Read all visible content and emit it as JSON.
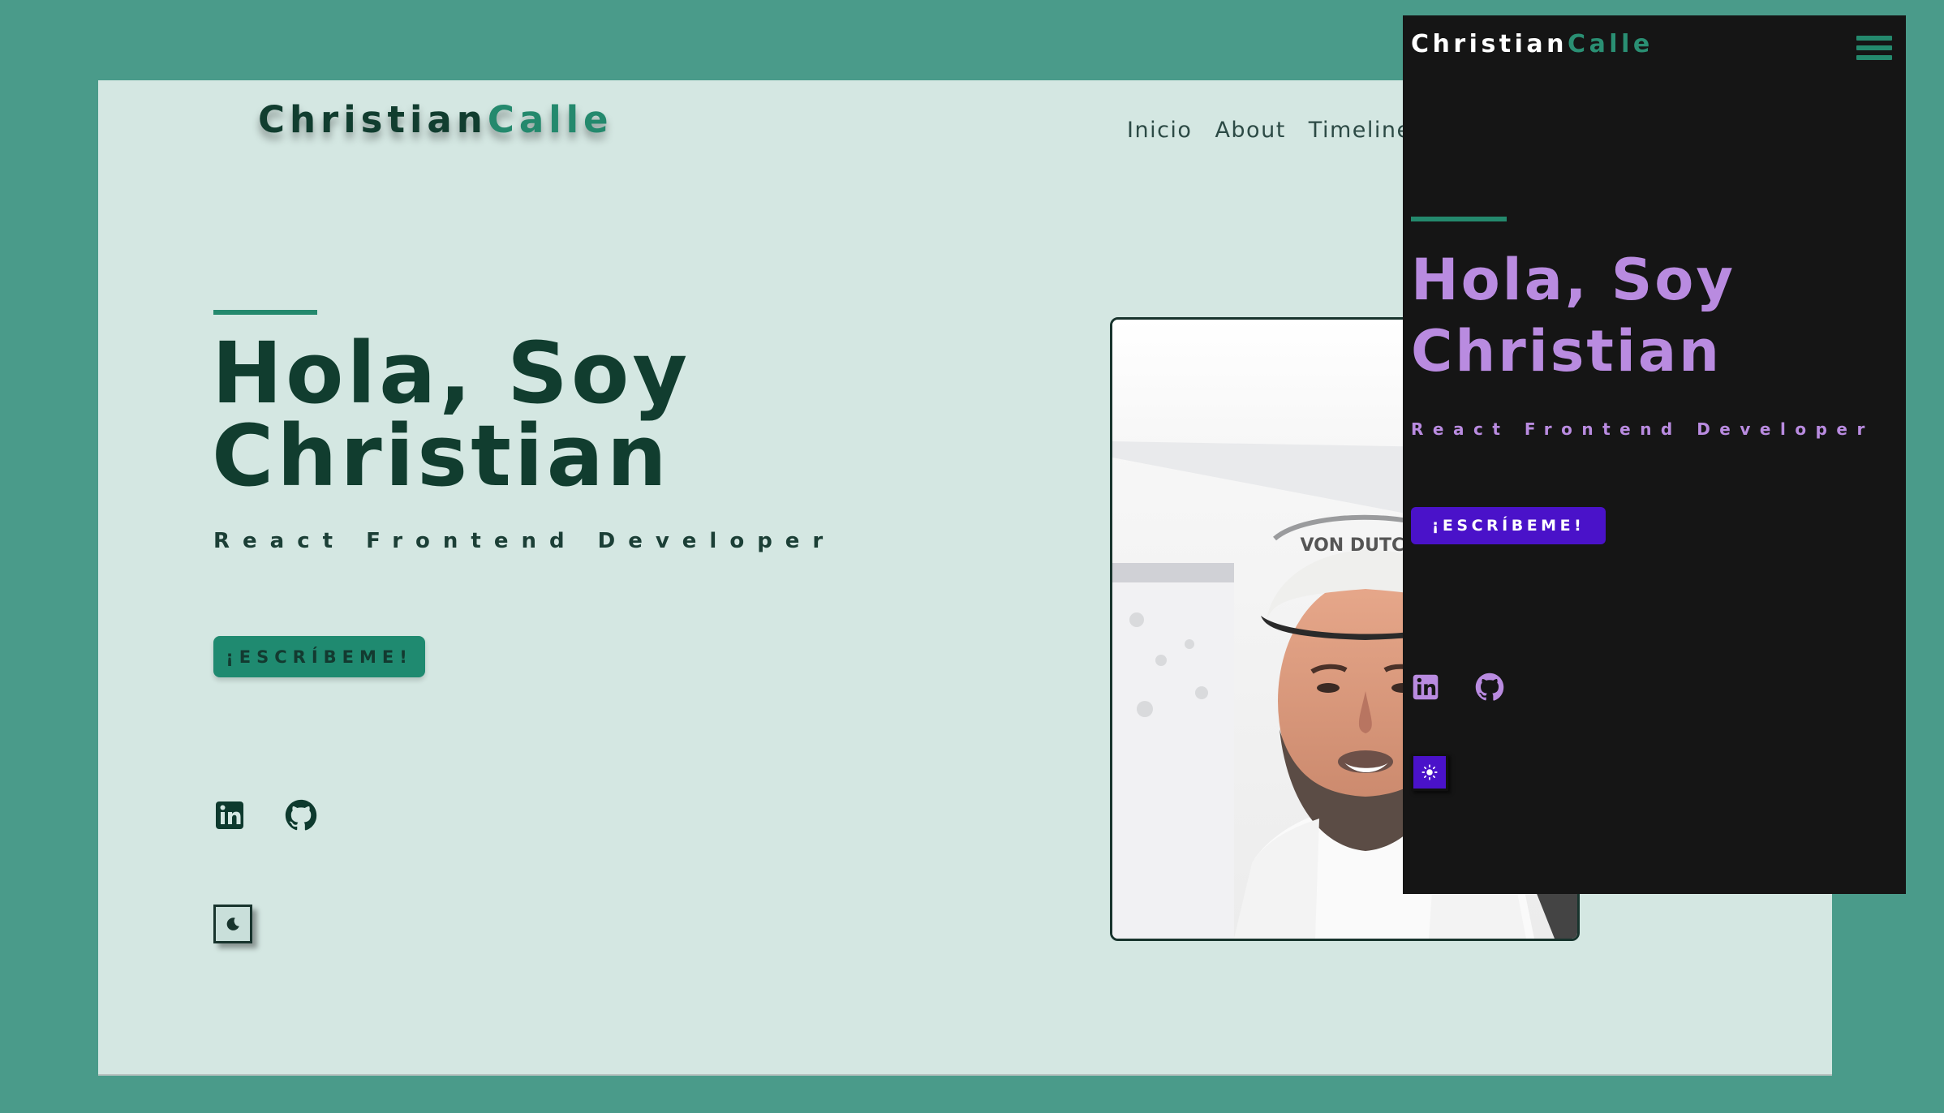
{
  "light_view": {
    "logo": {
      "first": "Christian",
      "last": "Calle"
    },
    "nav": [
      "Inicio",
      "About",
      "Timeline"
    ],
    "hero": {
      "title": "Hola, Soy Christian",
      "subtitle": "React Frontend Developer",
      "cta": "¡ESCRÍBEME!"
    },
    "socials": [
      {
        "icon": "linkedin-icon"
      },
      {
        "icon": "github-icon"
      }
    ],
    "theme_toggle_icon": "moon-icon",
    "photo_alt": "Christian Calle portrait photo",
    "colors": {
      "background": "#d4e7e2",
      "primary": "#113d2f",
      "accent": "#24896d"
    }
  },
  "dark_view": {
    "logo": {
      "first": "Christian",
      "last": "Calle"
    },
    "menu_icon": "hamburger-menu-icon",
    "hero": {
      "title": "Hola, Soy Christian",
      "subtitle": "React Frontend Developer",
      "cta": "¡ESCRÍBEME!"
    },
    "socials": [
      {
        "icon": "linkedin-icon"
      },
      {
        "icon": "github-icon"
      }
    ],
    "theme_toggle_icon": "sun-icon",
    "colors": {
      "background": "#151515",
      "primary": "#b98be0",
      "accent": "#4a12c9"
    }
  },
  "backdrop_color": "#4a9b8a"
}
